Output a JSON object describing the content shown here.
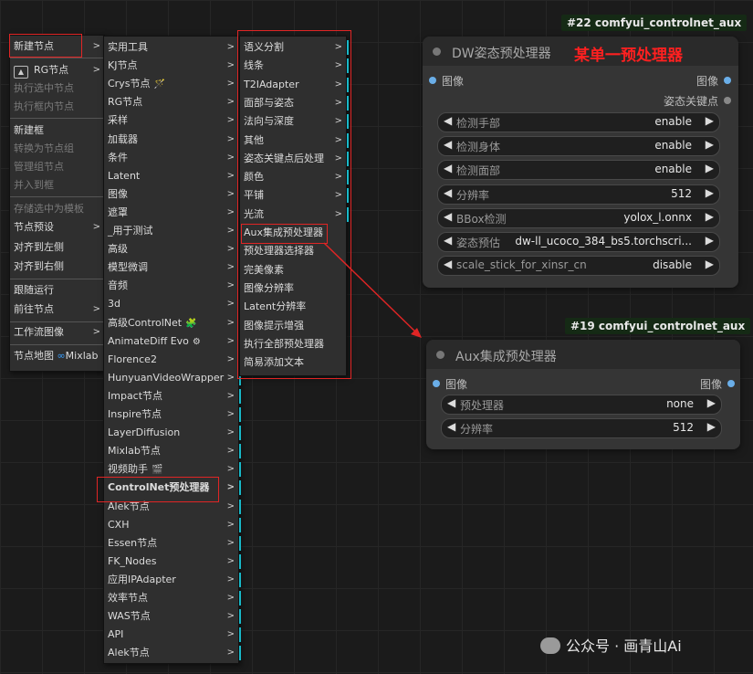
{
  "menu1": {
    "items": [
      {
        "label": "新建节点",
        "sub": true,
        "disabled": false
      },
      {
        "label": "RG节点",
        "sub": true,
        "disabled": false
      },
      {
        "label": "执行选中节点",
        "sub": false,
        "disabled": true
      },
      {
        "label": "执行框内节点",
        "sub": false,
        "disabled": true
      },
      {
        "label": "新建框",
        "sub": false,
        "disabled": false
      },
      {
        "label": "转换为节点组",
        "sub": false,
        "disabled": true
      },
      {
        "label": "管理组节点",
        "sub": false,
        "disabled": true
      },
      {
        "label": "并入到框",
        "sub": false,
        "disabled": true
      },
      {
        "label": "存储选中为模板",
        "sub": false,
        "disabled": true
      },
      {
        "label": "节点预设",
        "sub": true,
        "disabled": false
      },
      {
        "label": "对齐到左侧",
        "sub": false,
        "disabled": false
      },
      {
        "label": "对齐到右侧",
        "sub": false,
        "disabled": false
      },
      {
        "label": "跟随运行",
        "sub": false,
        "disabled": false
      },
      {
        "label": "前往节点",
        "sub": true,
        "disabled": false
      },
      {
        "label": "工作流图像",
        "sub": true,
        "disabled": false
      },
      {
        "label": "节点地图",
        "sub": false,
        "disabled": false,
        "extra": "Mixlab"
      }
    ]
  },
  "menu2": {
    "items": [
      {
        "label": "实用工具"
      },
      {
        "label": "KJ节点"
      },
      {
        "label": "Crys节点"
      },
      {
        "label": "RG节点"
      },
      {
        "label": "采样"
      },
      {
        "label": "加载器"
      },
      {
        "label": "条件"
      },
      {
        "label": "Latent"
      },
      {
        "label": "图像"
      },
      {
        "label": "遮罩"
      },
      {
        "label": "_用于测试"
      },
      {
        "label": "高级"
      },
      {
        "label": "模型微调"
      },
      {
        "label": "音频"
      },
      {
        "label": "3d"
      },
      {
        "label": "高级ControlNet"
      },
      {
        "label": "AnimateDiff Evo"
      },
      {
        "label": "Florence2"
      },
      {
        "label": "HunyuanVideoWrapper"
      },
      {
        "label": "Impact节点"
      },
      {
        "label": "Inspire节点"
      },
      {
        "label": "LayerDiffusion"
      },
      {
        "label": "Mixlab节点"
      },
      {
        "label": "视频助手"
      },
      {
        "label": "ControlNet预处理器"
      },
      {
        "label": "Alek节点"
      },
      {
        "label": "CXH"
      },
      {
        "label": "Essen节点"
      },
      {
        "label": "FK_Nodes"
      },
      {
        "label": "应用IPAdapter"
      },
      {
        "label": "效率节点"
      },
      {
        "label": "WAS节点"
      },
      {
        "label": "API"
      },
      {
        "label": "Alek节点"
      }
    ]
  },
  "menu3": {
    "items": [
      {
        "label": "语义分割",
        "sub": true
      },
      {
        "label": "线条",
        "sub": true
      },
      {
        "label": "T2IAdapter",
        "sub": true
      },
      {
        "label": "面部与姿态",
        "sub": true
      },
      {
        "label": "法向与深度",
        "sub": true
      },
      {
        "label": "其他",
        "sub": true
      },
      {
        "label": "姿态关键点后处理",
        "sub": true
      },
      {
        "label": "颜色",
        "sub": true
      },
      {
        "label": "平铺",
        "sub": true
      },
      {
        "label": "光流",
        "sub": true
      },
      {
        "label": "Aux集成预处理器",
        "sub": false
      },
      {
        "label": "预处理器选择器",
        "sub": false
      },
      {
        "label": "完美像素",
        "sub": false
      },
      {
        "label": "图像分辨率",
        "sub": false
      },
      {
        "label": "Latent分辨率",
        "sub": false
      },
      {
        "label": "图像提示增强",
        "sub": false
      },
      {
        "label": "执行全部预处理器",
        "sub": false
      },
      {
        "label": "简易添加文本",
        "sub": false
      }
    ]
  },
  "node1": {
    "badge": "#22 comfyui_controlnet_aux",
    "title": "DW姿态预处理器",
    "annotation": "某单一预处理器",
    "input": "图像",
    "outputs": [
      "图像",
      "姿态关键点"
    ],
    "widgets": [
      {
        "name": "检测手部",
        "value": "enable"
      },
      {
        "name": "检测身体",
        "value": "enable"
      },
      {
        "name": "检测面部",
        "value": "enable"
      },
      {
        "name": "分辨率",
        "value": "512"
      },
      {
        "name": "BBox检测",
        "value": "yolox_l.onnx"
      },
      {
        "name": "姿态预估",
        "value": "dw-ll_ucoco_384_bs5.torchscri..."
      },
      {
        "name": "scale_stick_for_xinsr_cn",
        "value": "disable"
      }
    ]
  },
  "node2": {
    "badge": "#19 comfyui_controlnet_aux",
    "title": "Aux集成预处理器",
    "input": "图像",
    "output": "图像",
    "widgets": [
      {
        "name": "预处理器",
        "value": "none"
      },
      {
        "name": "分辨率",
        "value": "512"
      }
    ]
  },
  "watermark": "公众号 · 画青山Ai",
  "colors": {
    "accent_red": "#e02525",
    "connector_cyan": "#18b8c8",
    "port_blue": "#6aaee8",
    "badge_bg": "#152a15"
  }
}
